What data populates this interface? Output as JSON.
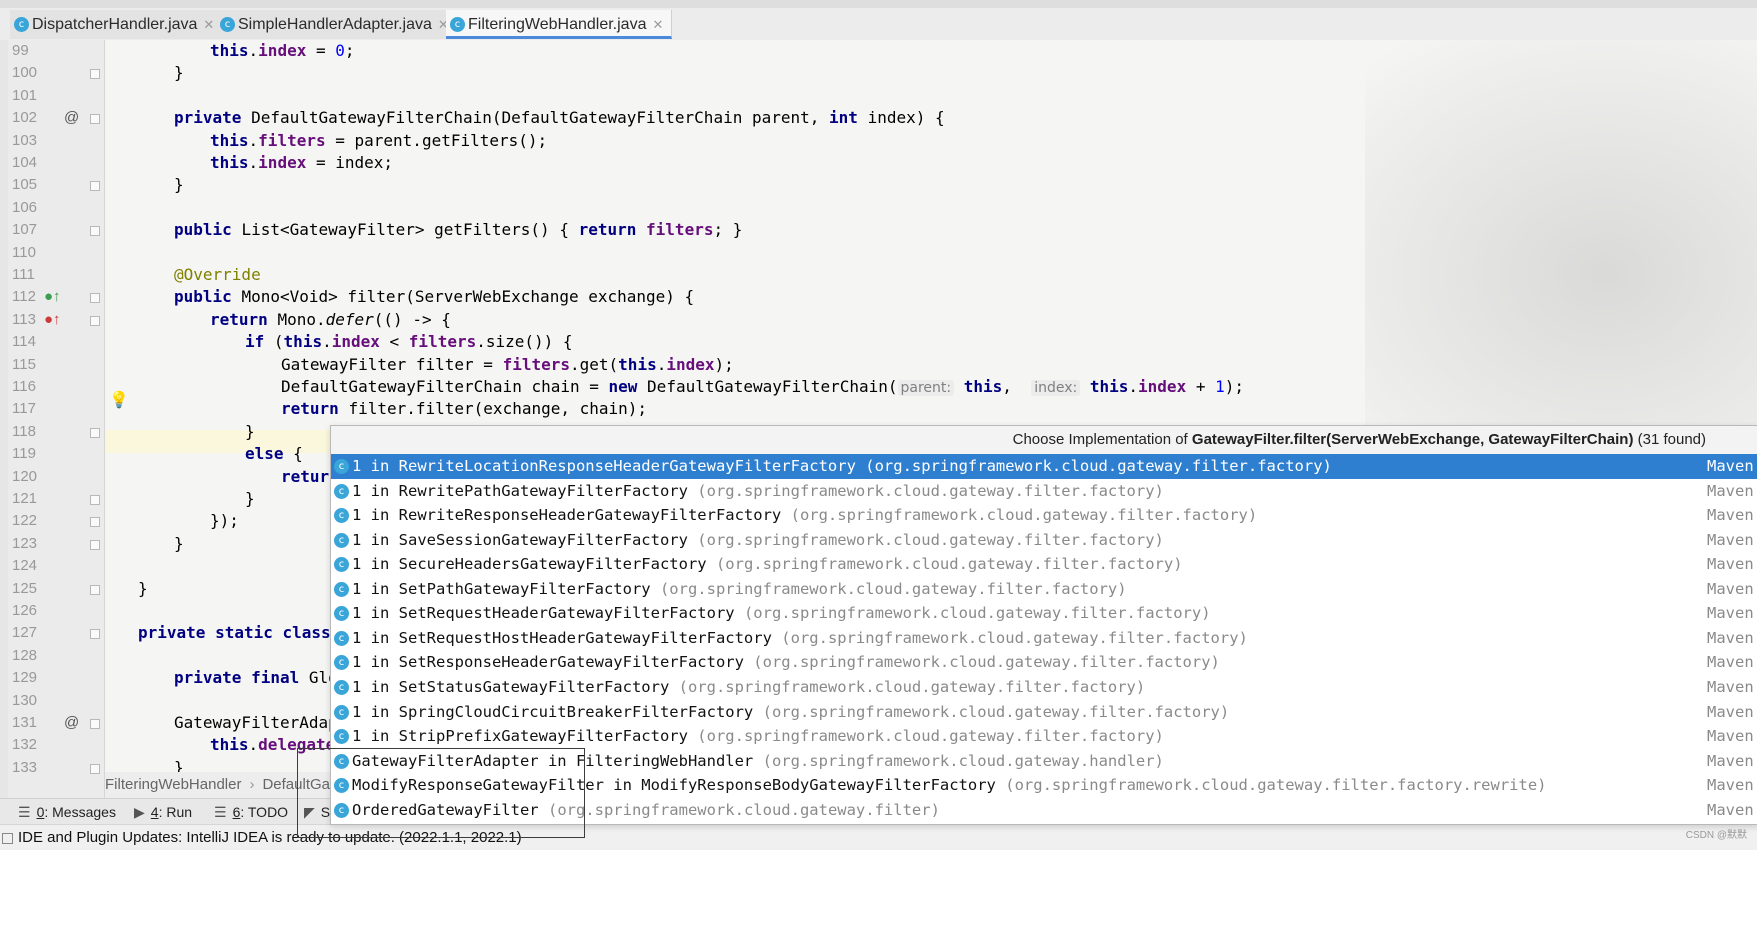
{
  "tabs": [
    {
      "label": "DispatcherHandler.java"
    },
    {
      "label": "SimpleHandlerAdapter.java"
    },
    {
      "label": "FilteringWebHandler.java"
    }
  ],
  "code": {
    "lines": [
      "99",
      "100",
      "101",
      "102",
      "103",
      "104",
      "105",
      "106",
      "107",
      "110",
      "111",
      "112",
      "113",
      "114",
      "115",
      "116",
      "117",
      "118",
      "119",
      "120",
      "121",
      "122",
      "123",
      "124",
      "125",
      "126",
      "127",
      "128",
      "129",
      "130",
      "131",
      "132",
      "133"
    ],
    "l99a": "this",
    "l99b": ".",
    "l99c": "index",
    "l99d": " = ",
    "l99e": "0",
    "l99f": ";",
    "brace_close": "}",
    "l102_private": "private ",
    "l102_name": "DefaultGatewayFilterChain(DefaultGatewayFilterChain parent, ",
    "l102_int": "int",
    "l102_rest": " index) {",
    "this": "this",
    "dot": ".",
    "filters": "filters",
    "index": "index",
    "l103_rest": " = parent.getFilters();",
    "l104_rest": " = index;",
    "l107_public": "public ",
    "l107_mid": "List<GatewayFilter> getFilters() { ",
    "l107_return": "return ",
    "l107_end": "; }",
    "l111_ann": "@Override",
    "l112_public": "public ",
    "l112_rest": "Mono<Void> filter(ServerWebExchange exchange) {",
    "l113_return": "return ",
    "l113_mid": "Mono.",
    "l113_defer": "defer",
    "l113_rest": "(() -> {",
    "l114_if": "if ",
    "l114_open": "(",
    "l114_mid": " < ",
    "l114_rest": ".size()) {",
    "l115_a": "GatewayFilter filter = ",
    "l115_b": ".get(",
    "l115_c": ");",
    "l116_a": "DefaultGatewayFilterChain chain = ",
    "l116_new": "new ",
    "l116_b": "DefaultGatewayFilterChain(",
    "l116_hint1": "parent:",
    "l116_c": ",  ",
    "l116_hint2": "index:",
    "l116_d": " + ",
    "l116_one": "1",
    "l116_e": ");",
    "l117_return": "return ",
    "l117_rest": "filter.filter(exchange, chain);",
    "l119_else": "else ",
    "l119_brace": "{",
    "l120_return": "return",
    "l122": "});",
    "l127_a": "private static class ",
    "l127_b": "G",
    "l129_a": "private final ",
    "l129_b": "Glob",
    "l131": "GatewayFilterAdapt",
    "l132_rest": "delegate"
  },
  "popup": {
    "title_prefix": "Choose Implementation of ",
    "title_bold": "GatewayFilter.filter(ServerWebExchange, GatewayFilterChain)",
    "title_suffix": " (31 found)",
    "items": [
      {
        "name": "1 in RewriteLocationResponseHeaderGatewayFilterFactory",
        "pkg": "(org.springframework.cloud.gateway.filter.factory)",
        "lib": "Maven:"
      },
      {
        "name": "1 in RewritePathGatewayFilterFactory",
        "pkg": "(org.springframework.cloud.gateway.filter.factory)",
        "lib": "Maven:"
      },
      {
        "name": "1 in RewriteResponseHeaderGatewayFilterFactory",
        "pkg": "(org.springframework.cloud.gateway.filter.factory)",
        "lib": "Maven:"
      },
      {
        "name": "1 in SaveSessionGatewayFilterFactory",
        "pkg": "(org.springframework.cloud.gateway.filter.factory)",
        "lib": "Maven:"
      },
      {
        "name": "1 in SecureHeadersGatewayFilterFactory",
        "pkg": "(org.springframework.cloud.gateway.filter.factory)",
        "lib": "Maven:"
      },
      {
        "name": "1 in SetPathGatewayFilterFactory",
        "pkg": "(org.springframework.cloud.gateway.filter.factory)",
        "lib": "Maven:"
      },
      {
        "name": "1 in SetRequestHeaderGatewayFilterFactory",
        "pkg": "(org.springframework.cloud.gateway.filter.factory)",
        "lib": "Maven:"
      },
      {
        "name": "1 in SetRequestHostHeaderGatewayFilterFactory",
        "pkg": "(org.springframework.cloud.gateway.filter.factory)",
        "lib": "Maven:"
      },
      {
        "name": "1 in SetResponseHeaderGatewayFilterFactory",
        "pkg": "(org.springframework.cloud.gateway.filter.factory)",
        "lib": "Maven:"
      },
      {
        "name": "1 in SetStatusGatewayFilterFactory",
        "pkg": "(org.springframework.cloud.gateway.filter.factory)",
        "lib": "Maven:"
      },
      {
        "name": "1 in SpringCloudCircuitBreakerFilterFactory",
        "pkg": "(org.springframework.cloud.gateway.filter.factory)",
        "lib": "Maven:"
      },
      {
        "name": "1 in StripPrefixGatewayFilterFactory",
        "pkg": "(org.springframework.cloud.gateway.filter.factory)",
        "lib": "Maven:"
      },
      {
        "name": "GatewayFilterAdapter in FilteringWebHandler",
        "pkg": "(org.springframework.cloud.gateway.handler)",
        "lib": "Maven:"
      },
      {
        "name": "ModifyResponseGatewayFilter in ModifyResponseBodyGatewayFilterFactory",
        "pkg": "(org.springframework.cloud.gateway.filter.factory.rewrite)",
        "lib": "Maven:"
      },
      {
        "name": "OrderedGatewayFilter",
        "pkg": "(org.springframework.cloud.gateway.filter)",
        "lib": "Maven:"
      }
    ],
    "selected_index": 0
  },
  "breadcrumb": {
    "item1": "FilteringWebHandler",
    "item2": "DefaultGa"
  },
  "toolwindows": [
    {
      "num": "0",
      "label": ": Messages"
    },
    {
      "num": "4",
      "label": ": Run"
    },
    {
      "num": "6",
      "label": ": TODO"
    },
    {
      "num": "",
      "label": "S"
    }
  ],
  "status": {
    "message": "IDE and Plugin Updates: IntelliJ IDEA is ready to update. (2022.1.1, 2022.1)",
    "watermark": "CSDN @默默"
  },
  "colors": {
    "selection": "#2f7fd0",
    "keyword": "#000080",
    "field": "#660e7a",
    "annotation": "#808000",
    "number": "#0000ff",
    "caretline": "#fbf7dc"
  }
}
